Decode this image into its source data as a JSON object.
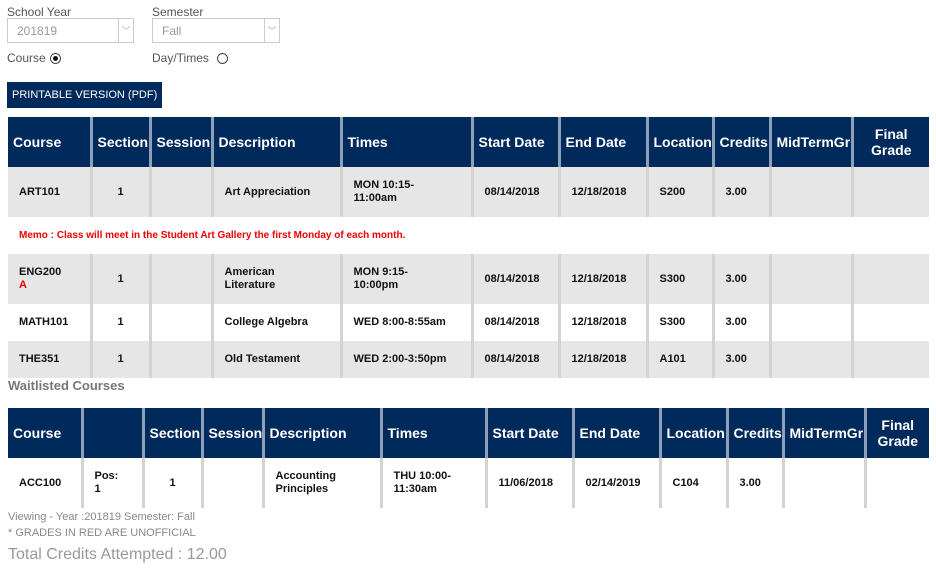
{
  "filters": {
    "year_label": "School Year",
    "year_value": "201819",
    "semester_label": "Semester",
    "semester_value": "Fall",
    "radio_course": "Course",
    "radio_daytimes": "Day/Times",
    "selected": "Course"
  },
  "print_button": "PRINTABLE VERSION (PDF)",
  "enrolled": {
    "headers": [
      "Course",
      "Section",
      "Session",
      "Description",
      "Times",
      "Start Date",
      "End Date",
      "Location",
      "Credits",
      "MidTermGr",
      "Final Grade"
    ],
    "rows": [
      {
        "course": "ART101",
        "grade": "",
        "section": "1",
        "session": "",
        "description": "Art Appreciation",
        "times": "MON 10:15-11:00am",
        "start": "08/14/2018",
        "end": "12/18/2018",
        "location": "S200",
        "credits": "3.00",
        "midterm": "",
        "final": ""
      },
      {
        "course": "ENG200",
        "grade": "A",
        "section": "1",
        "session": "",
        "description": "American Literature",
        "times": "MON 9:15-10:00pm",
        "start": "08/14/2018",
        "end": "12/18/2018",
        "location": "S300",
        "credits": "3.00",
        "midterm": "",
        "final": ""
      },
      {
        "course": "MATH101",
        "grade": "",
        "section": "1",
        "session": "",
        "description": "College Algebra",
        "times": "WED 8:00-8:55am",
        "start": "08/14/2018",
        "end": "12/18/2018",
        "location": "S300",
        "credits": "3.00",
        "midterm": "",
        "final": ""
      },
      {
        "course": "THE351",
        "grade": "",
        "section": "1",
        "session": "",
        "description": "Old Testament",
        "times": "WED 2:00-3:50pm",
        "start": "08/14/2018",
        "end": "12/18/2018",
        "location": "A101",
        "credits": "3.00",
        "midterm": "",
        "final": ""
      }
    ],
    "memo": "Memo : Class will meet in the Student Art Gallery the first Monday of each month."
  },
  "waitlisted": {
    "title": "Waitlisted Courses",
    "headers": [
      "Course",
      "",
      "Section",
      "Session",
      "Description",
      "Times",
      "Start Date",
      "End Date",
      "Location",
      "Credits",
      "MidTermGr",
      "Final Grade"
    ],
    "rows": [
      {
        "course": "ACC100",
        "pos": "Pos: 1",
        "section": "1",
        "session": "",
        "description": "Accounting Principles",
        "times": "THU 10:00-11:30am",
        "start": "11/06/2018",
        "end": "02/14/2019",
        "location": "C104",
        "credits": "3.00",
        "midterm": "",
        "final": ""
      }
    ]
  },
  "footer": {
    "viewing": "Viewing - Year :201819 Semester: Fall",
    "note": "* GRADES IN RED ARE UNOFFICIAL",
    "total": "Total Credits Attempted : 12.00"
  }
}
